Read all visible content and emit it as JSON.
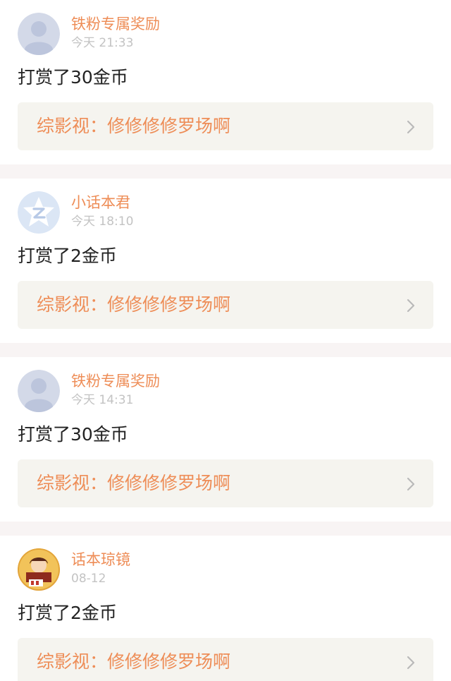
{
  "feed": {
    "items": [
      {
        "username": "铁粉专属奖励",
        "time": "今天 21:33",
        "action": "打赏了30金币",
        "book_title": "综影视：修修修修罗场啊",
        "avatar_icon": "default-user-avatar-icon"
      },
      {
        "username": "小话本君",
        "time": "今天 18:10",
        "action": "打赏了2金币",
        "book_title": "综影视：修修修修罗场啊",
        "avatar_icon": "z-logo-avatar-icon"
      },
      {
        "username": "铁粉专属奖励",
        "time": "今天 14:31",
        "action": "打赏了30金币",
        "book_title": "综影视：修修修修罗场啊",
        "avatar_icon": "default-user-avatar-icon"
      },
      {
        "username": "话本琼镜",
        "time": "08-12",
        "action": "打赏了2金币",
        "book_title": "综影视：修修修修罗场啊",
        "avatar_icon": "illustrated-avatar-icon"
      }
    ]
  },
  "colors": {
    "accent": "#ee8d57",
    "timestamp": "#c3c3c3",
    "body_text": "#222222",
    "book_row_bg": "#f5f4ef",
    "separator": "#f8f4f4"
  }
}
